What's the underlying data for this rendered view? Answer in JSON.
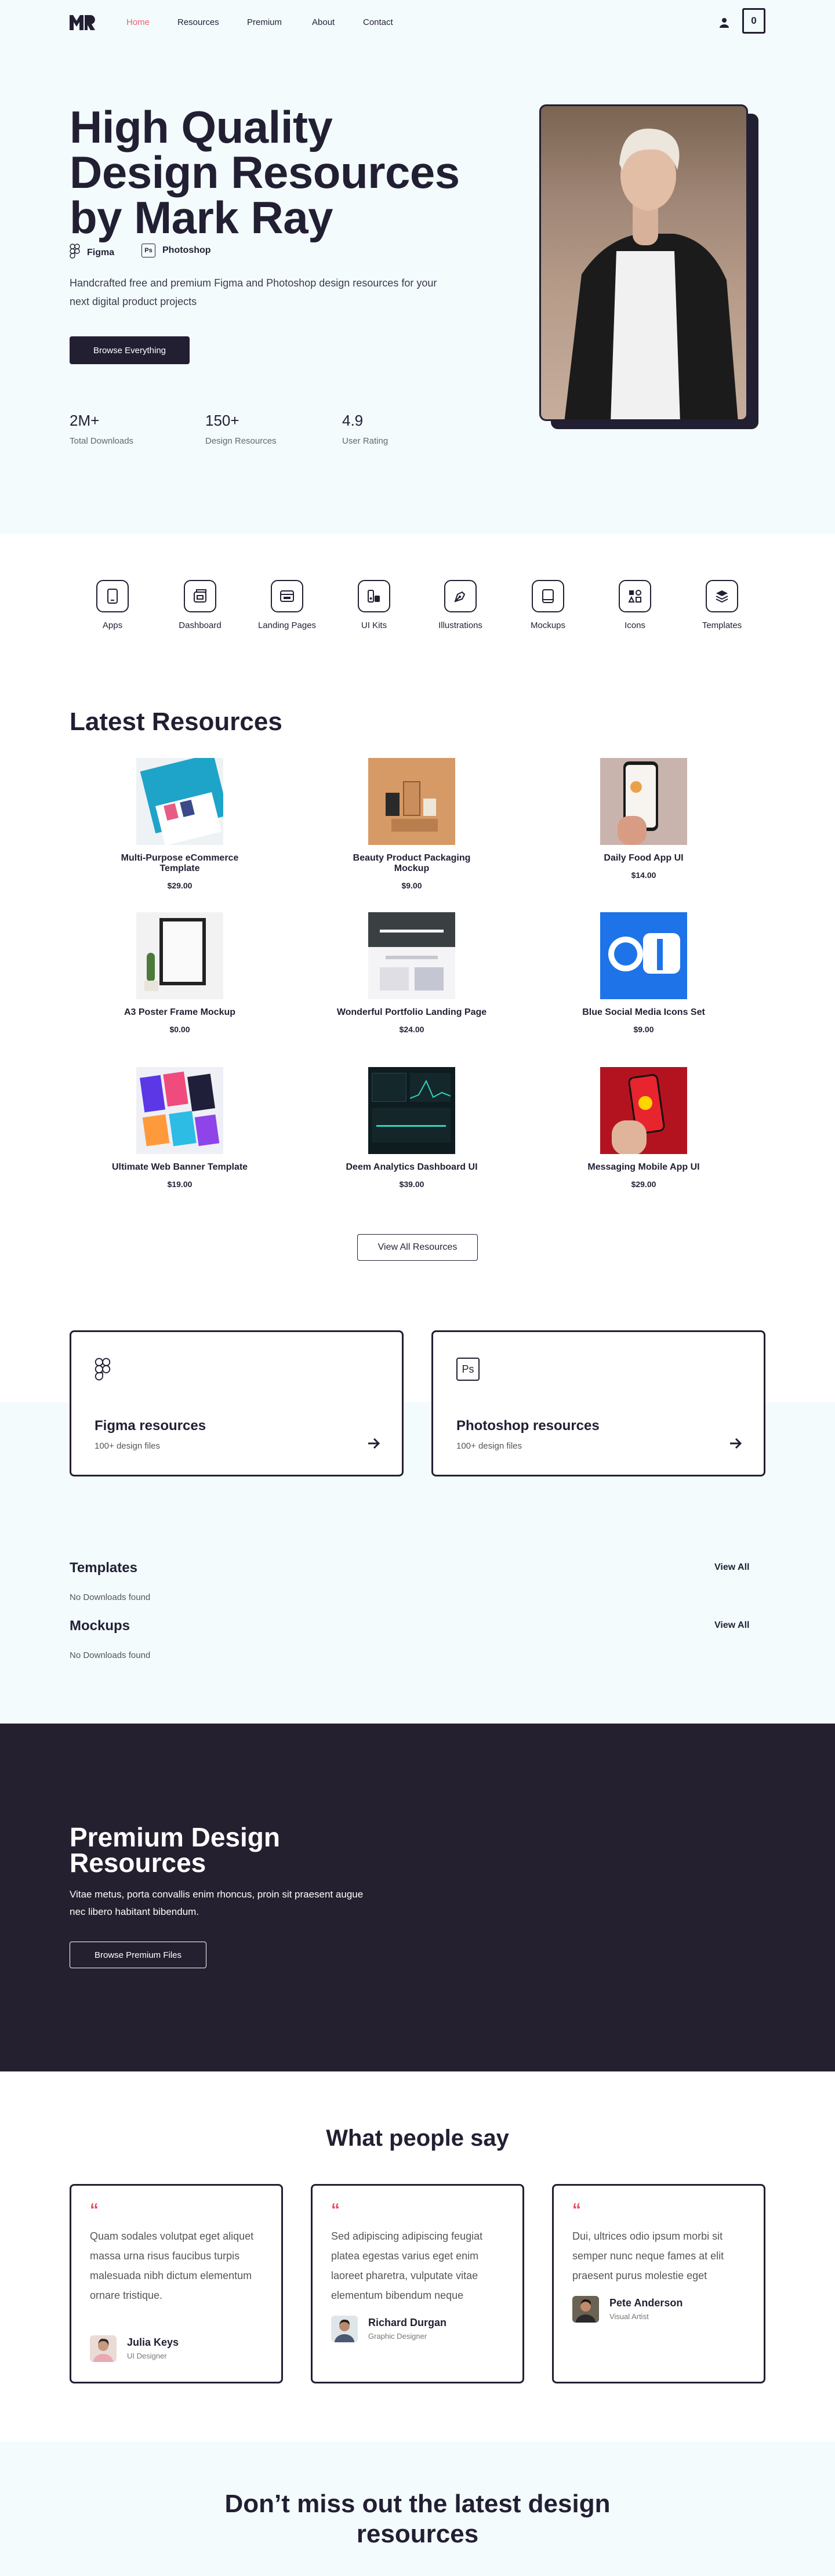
{
  "nav": {
    "logo": "MR",
    "links": [
      "Home",
      "Resources",
      "Premium",
      "About",
      "Contact"
    ],
    "cart_count": "0"
  },
  "hero": {
    "title_lines": [
      "High Quality",
      "Design Resources",
      "by Mark Ray"
    ],
    "tools": [
      {
        "icon": "figma-icon",
        "label": "Figma"
      },
      {
        "icon": "photoshop-icon",
        "label": "Photoshop",
        "badge": "Ps"
      }
    ],
    "description": "Handcrafted free and premium Figma and Photoshop design resources for your next digital product projects",
    "cta": "Browse Everything",
    "stats": [
      {
        "value": "2M+",
        "label": "Total Downloads"
      },
      {
        "value": "150+",
        "label": "Design Resources"
      },
      {
        "value": "4.9",
        "label": "User Rating"
      }
    ]
  },
  "categories": [
    {
      "icon": "phone-icon",
      "label": "Apps"
    },
    {
      "icon": "dashboard-icon",
      "label": "Dashboard"
    },
    {
      "icon": "browser-icon",
      "label": "Landing Pages"
    },
    {
      "icon": "ui-kit-icon",
      "label": "UI Kits"
    },
    {
      "icon": "pen-tool-icon",
      "label": "Illustrations"
    },
    {
      "icon": "tablet-icon",
      "label": "Mockups"
    },
    {
      "icon": "shapes-icon",
      "label": "Icons"
    },
    {
      "icon": "layers-icon",
      "label": "Templates"
    }
  ],
  "latest": {
    "title": "Latest Resources",
    "items": [
      {
        "title": "Multi-Purpose eCommerce Template",
        "price": "$29.00"
      },
      {
        "title": "Beauty Product Packaging Mockup",
        "price": "$9.00"
      },
      {
        "title": "Daily Food App UI",
        "price": "$14.00"
      },
      {
        "title": "A3 Poster Frame Mockup",
        "price": "$0.00"
      },
      {
        "title": "Wonderful Portfolio Landing Page",
        "price": "$24.00"
      },
      {
        "title": "Blue Social Media Icons Set",
        "price": "$9.00"
      },
      {
        "title": "Ultimate Web Banner Template",
        "price": "$19.00"
      },
      {
        "title": "Deem Analytics Dashboard UI",
        "price": "$39.00"
      },
      {
        "title": "Messaging Mobile App UI",
        "price": "$29.00"
      }
    ],
    "view_all": "View All Resources"
  },
  "tool_cards": [
    {
      "title": "Figma resources",
      "subtitle": "100+ design files"
    },
    {
      "title": "Photoshop resources",
      "subtitle": "100+ design files",
      "badge": "Ps"
    }
  ],
  "sections": [
    {
      "title": "Templates",
      "view_all": "View All",
      "empty": "No Downloads found"
    },
    {
      "title": "Mockups",
      "view_all": "View All",
      "empty": "No Downloads found"
    }
  ],
  "premium": {
    "title": "Premium Design Resources",
    "text": "Vitae metus, porta convallis enim rhoncus, proin sit praesent augue nec libero habitant bibendum.",
    "cta": "Browse Premium Files"
  },
  "testimonials": {
    "title": "What people say",
    "quote_mark": "“",
    "items": [
      {
        "text": "Quam sodales volutpat eget aliquet massa urna risus faucibus turpis malesuada nibh dictum elementum ornare tristique.",
        "name": "Julia Keys",
        "role": "UI Designer"
      },
      {
        "text": "Sed adipiscing adipiscing feugiat platea egestas varius eget enim laoreet pharetra, vulputate vitae elementum bibendum neque",
        "name": "Richard Durgan",
        "role": "Graphic Designer"
      },
      {
        "text": "Dui, ultrices odio ipsum morbi sit semper nunc neque fames at elit praesent purus molestie eget",
        "name": "Pete Anderson",
        "role": "Visual Artist"
      }
    ]
  },
  "newsletter": {
    "title": "Don’t miss out the latest design resources"
  },
  "colors": {
    "dark": "#221f33",
    "accent": "#f25f75",
    "light_bg": "#f3fbfd"
  }
}
